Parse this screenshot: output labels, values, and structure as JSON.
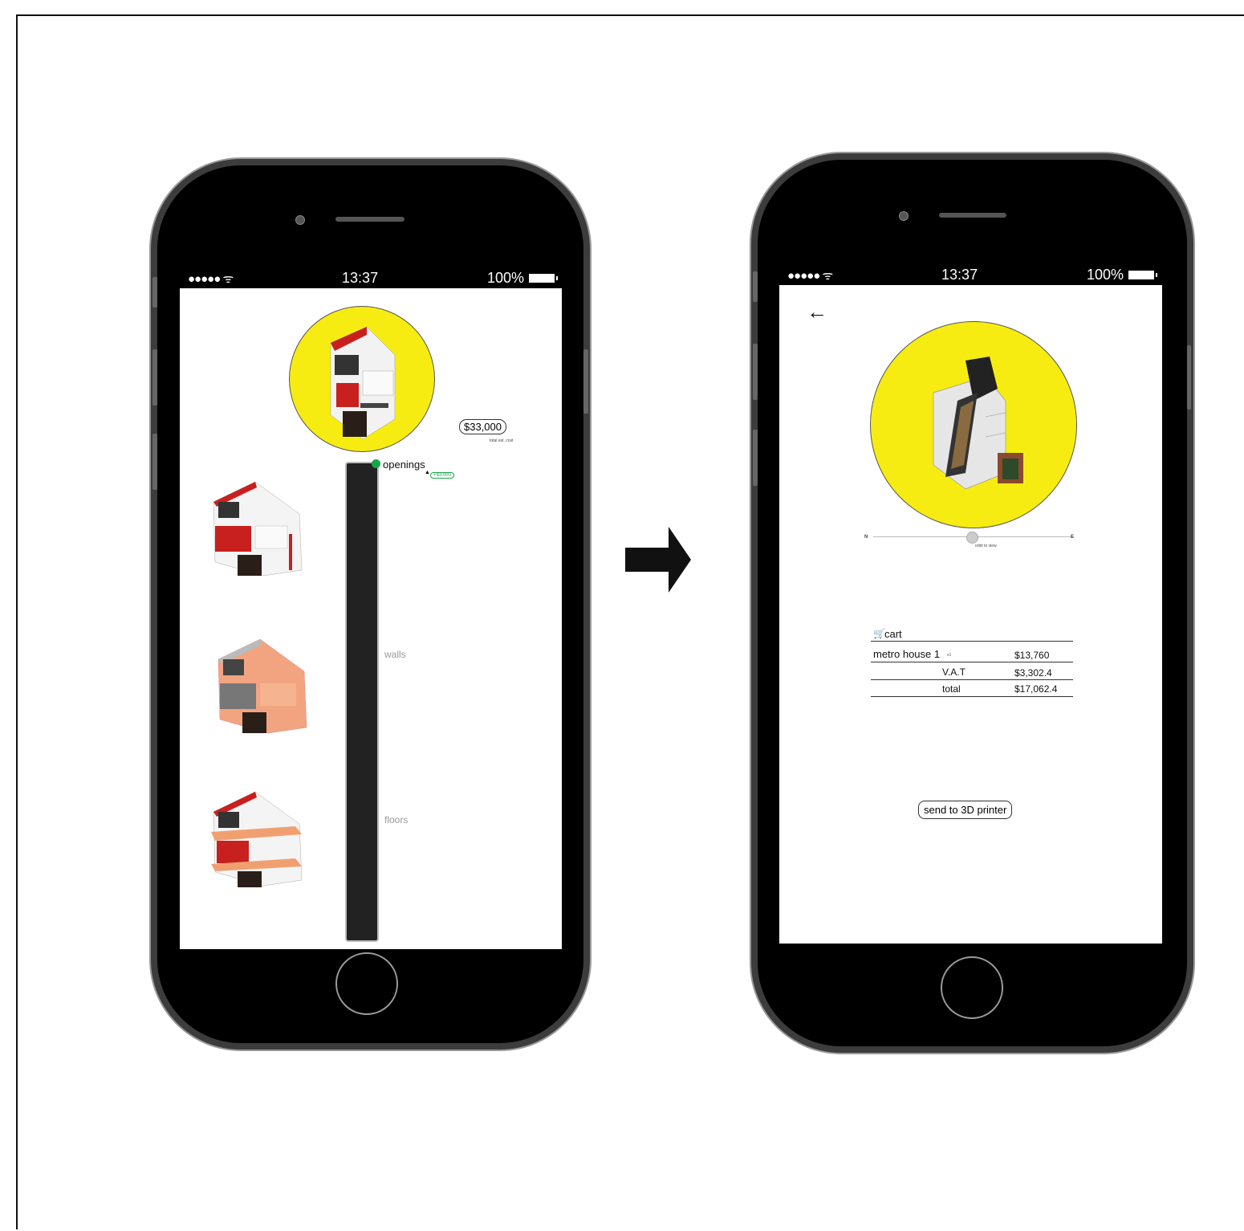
{
  "left_phone": {
    "status": {
      "signal": "●●●●● ᯤ",
      "time": "13:37",
      "battery": "100%"
    },
    "total_cost": "$33,000",
    "total_cost_caption": "total est. cost",
    "slider_labels": {
      "openings": "openings",
      "walls": "walls",
      "floors": "floors"
    },
    "openings_delta": "+$3,000"
  },
  "right_phone": {
    "status": {
      "signal": "●●●●● ᯤ",
      "time": "13:37",
      "battery": "100%"
    },
    "back_arrow": "←",
    "orbit": {
      "north": "N",
      "east": "E",
      "caption": "orbit to view"
    },
    "cart": {
      "title": "cart",
      "item": "metro house 1",
      "qty": "x1",
      "item_price": "$13,760",
      "vat_label": "V.A.T",
      "vat_value": "$3,302.4",
      "total_label": "total",
      "total_value": "$17,062.4"
    },
    "send_button": "send to 3D printer"
  },
  "colors": {
    "accent_yellow": "#f7ec11",
    "active_green": "#17a64a",
    "phone_body": "#4a4a4a"
  }
}
